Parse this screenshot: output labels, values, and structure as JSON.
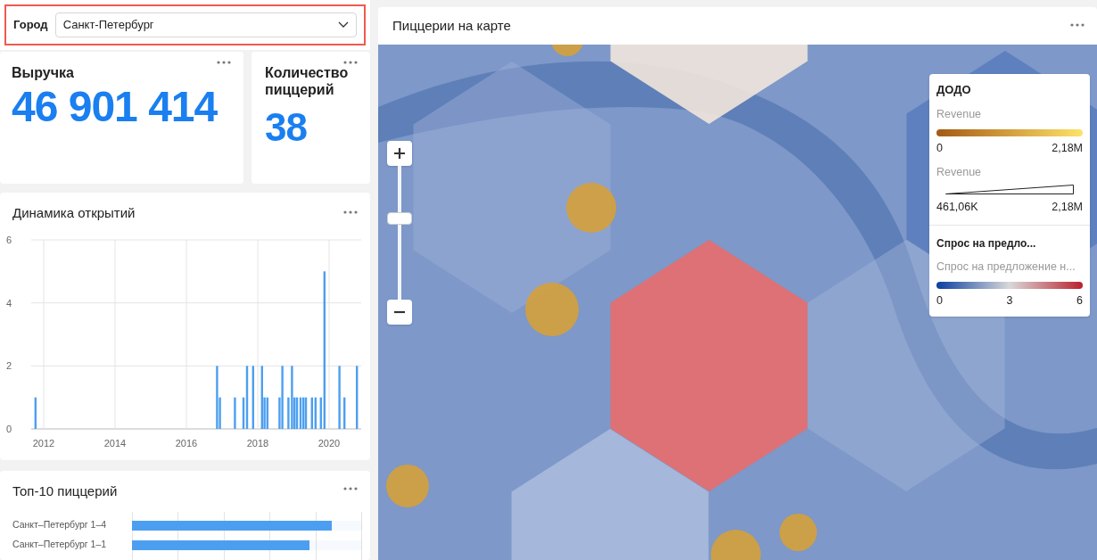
{
  "filter": {
    "label": "Город",
    "value": "Санкт-Петербург"
  },
  "kpis": [
    {
      "title": "Выручка",
      "value": "46 901 414"
    },
    {
      "title": "Количество пиццерий",
      "value": "38"
    }
  ],
  "openings": {
    "title": "Динамика открытий",
    "chart_data": {
      "type": "bar",
      "x": [
        2011.77,
        2016.86,
        2016.94,
        2017.36,
        2017.6,
        2017.7,
        2017.87,
        2018.12,
        2018.19,
        2018.27,
        2018.61,
        2018.69,
        2018.86,
        2018.96,
        2019.03,
        2019.1,
        2019.2,
        2019.28,
        2019.35,
        2019.52,
        2019.62,
        2019.77,
        2019.87,
        2020.29,
        2020.43,
        2020.78
      ],
      "values": [
        1,
        2,
        1,
        1,
        1,
        2,
        2,
        2,
        1,
        1,
        1,
        2,
        1,
        2,
        1,
        1,
        1,
        1,
        1,
        1,
        1,
        1,
        5,
        2,
        1,
        2
      ],
      "xlim": [
        2011.65,
        2020.9
      ],
      "ylim": [
        0,
        6
      ],
      "grid": true,
      "xticks": [
        2012,
        2014,
        2016,
        2018,
        2020
      ],
      "yticks": [
        0,
        2,
        4,
        6
      ]
    }
  },
  "top": {
    "title": "Топ-10 пиццерий",
    "rows": [
      {
        "label": "Санкт–Петербург 1–4",
        "level": 0.87
      },
      {
        "label": "Санкт–Петербург 1–1",
        "level": 0.77
      }
    ]
  },
  "map": {
    "title": "Пиццерии на карте",
    "zoom": {
      "level": 0.62
    },
    "legend": {
      "title": "ДОДО",
      "sections": [
        {
          "kind": "gradient",
          "label": "Revenue",
          "min": "0",
          "max": "2,18M"
        },
        {
          "kind": "size",
          "label": "Revenue",
          "min": "461,06K",
          "max": "2,18M"
        }
      ],
      "layer_title": "Спрос на предло...",
      "layer_label": "Спрос на предложение н...",
      "layer_ticks": [
        "0",
        "3",
        "6"
      ]
    }
  }
}
